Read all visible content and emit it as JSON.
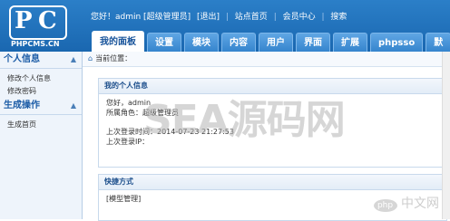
{
  "logo": {
    "letters_left": "P",
    "letters_right": "C",
    "text": "PHPCMS.CN"
  },
  "toplinks": {
    "greeting": "您好！admin [超级管理员]",
    "logout": "[退出]",
    "site_home": "站点首页",
    "member_center": "会员中心",
    "search": "搜索",
    "separator": "|"
  },
  "tabs": [
    {
      "label": "我的面板"
    },
    {
      "label": "设置"
    },
    {
      "label": "模块"
    },
    {
      "label": "内容"
    },
    {
      "label": "用户"
    },
    {
      "label": "界面"
    },
    {
      "label": "扩展"
    },
    {
      "label": "phpsso"
    },
    {
      "label": "默"
    }
  ],
  "sidebar": {
    "sections": [
      {
        "title": "个人信息",
        "items": [
          {
            "label": "修改个人信息"
          },
          {
            "label": "修改密码"
          }
        ]
      },
      {
        "title": "生成操作",
        "items": [
          {
            "label": "生成首页"
          }
        ]
      }
    ]
  },
  "breadcrumb": {
    "label": "当前位置："
  },
  "info_panel": {
    "title": "我的个人信息",
    "greeting": "您好，admin",
    "role": "所属角色：超级管理员",
    "last_login_time": "上次登录时间：2014-07-23 21:27:53",
    "last_login_ip": "上次登录IP："
  },
  "quick_panel": {
    "title": "快捷方式",
    "item": "[模型管理]"
  },
  "watermark": {
    "text": "SEA源码网",
    "badge": "php",
    "badge_text": "中文网"
  },
  "colors": {
    "header_blue": "#1a67b0",
    "active_tab_text": "#17539a",
    "sidebar_bg": "#eef4fb"
  }
}
